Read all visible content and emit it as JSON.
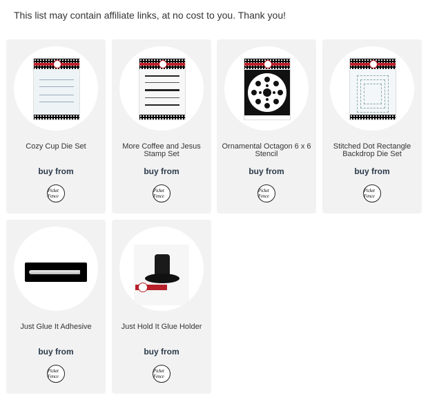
{
  "disclaimer": "This list may contain affiliate links, at no cost to you. Thank you!",
  "buy_label": "buy from",
  "store_logo_text": "Picket Fence",
  "products": [
    {
      "title": "Cozy Cup Die Set"
    },
    {
      "title": "More Coffee and Jesus Stamp Set"
    },
    {
      "title": "Ornamental Octagon 6 x 6 Stencil"
    },
    {
      "title": "Stitched Dot Rectangle Backdrop Die Set"
    },
    {
      "title": "Just Glue It Adhesive"
    },
    {
      "title": "Just Hold It Glue Holder"
    }
  ]
}
